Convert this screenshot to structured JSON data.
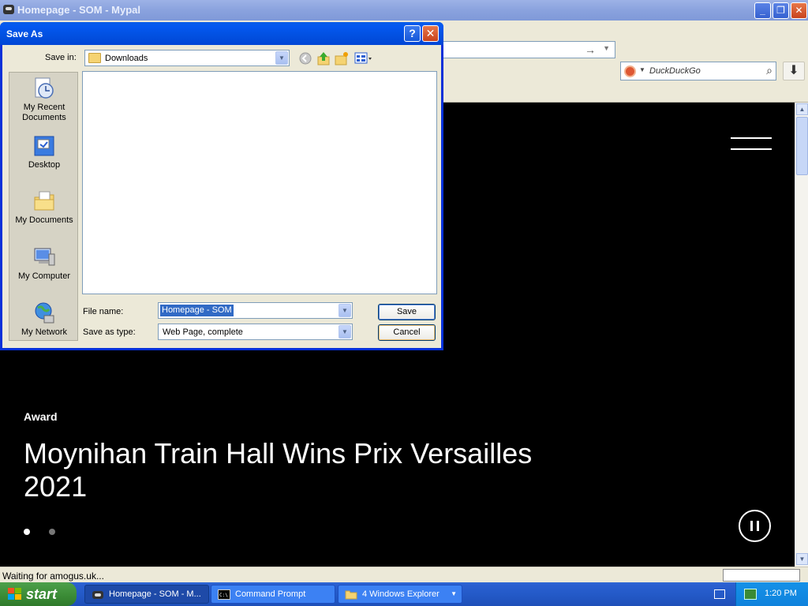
{
  "browser": {
    "title": "Homepage - SOM - Mypal",
    "controls": {
      "minimize": "_",
      "maximize": "❐",
      "close": "✕"
    },
    "search": {
      "engine": "DuckDuckGo",
      "placeholder": "DuckDuckGo"
    },
    "status_text": "Waiting for amogus.uk..."
  },
  "page": {
    "eyebrow": "Award",
    "headline": "Moynihan Train Hall Wins Prix Versailles 2021",
    "slides": 2,
    "active_slide": 1
  },
  "dialog": {
    "title": "Save As",
    "help": "?",
    "close": "✕",
    "save_in_label": "Save in:",
    "save_in_value": "Downloads",
    "places": [
      {
        "label": "My Recent Documents",
        "icon": "recent-documents-icon"
      },
      {
        "label": "Desktop",
        "icon": "desktop-icon"
      },
      {
        "label": "My Documents",
        "icon": "my-documents-icon"
      },
      {
        "label": "My Computer",
        "icon": "my-computer-icon"
      },
      {
        "label": "My Network",
        "icon": "my-network-icon"
      }
    ],
    "file_name_label": "File name:",
    "file_name_value": "Homepage - SOM",
    "save_as_type_label": "Save as type:",
    "save_as_type_value": "Web Page, complete",
    "save_button": "Save",
    "cancel_button": "Cancel"
  },
  "taskbar": {
    "start_label": "start",
    "tasks": [
      {
        "label": "Homepage - SOM - M...",
        "icon": "mypal-icon",
        "active": true
      },
      {
        "label": "Command Prompt",
        "icon": "cmd-icon",
        "active": false
      },
      {
        "label": "4 Windows Explorer",
        "icon": "folder-icon",
        "active": false
      }
    ],
    "clock": "1:20 PM"
  },
  "colors": {
    "dialog_title": "#0458f0",
    "taskbar": "#245ac8",
    "start_button": "#3a8a35",
    "selection": "#316ac5"
  }
}
